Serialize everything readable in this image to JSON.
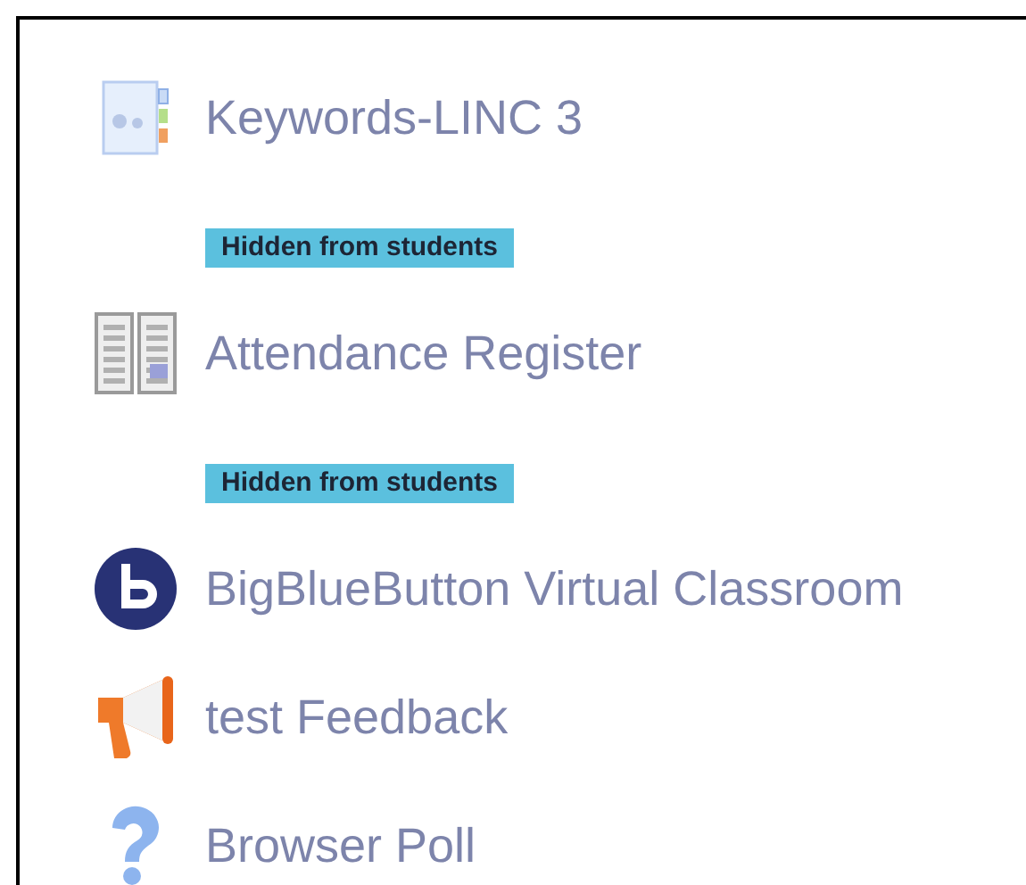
{
  "activities": [
    {
      "kind": "glossary",
      "title": "Keywords-LINC 3",
      "badge": "Hidden from students"
    },
    {
      "kind": "attendance",
      "title": "Attendance Register",
      "badge": "Hidden from students"
    },
    {
      "kind": "bigbluebutton",
      "title": "BigBlueButton Virtual Classroom"
    },
    {
      "kind": "feedback",
      "title": "test Feedback"
    },
    {
      "kind": "poll",
      "title": "Browser Poll"
    }
  ]
}
